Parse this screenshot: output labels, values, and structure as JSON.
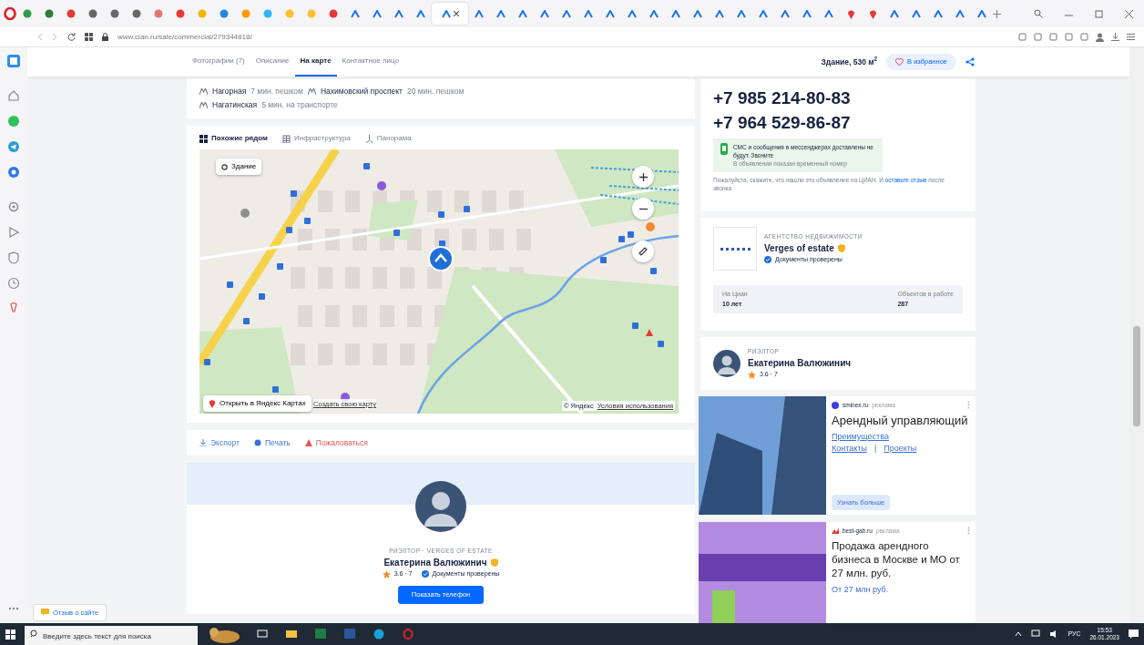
{
  "browser": {
    "tabs": [
      {
        "kind": "site",
        "color": "#2e9d4a",
        "selected": false
      },
      {
        "kind": "site",
        "color": "#2e7d32",
        "selected": false
      },
      {
        "kind": "site",
        "color": "#e53935",
        "selected": false
      },
      {
        "kind": "site",
        "color": "#666666",
        "selected": false
      },
      {
        "kind": "site",
        "color": "#666666",
        "selected": false
      },
      {
        "kind": "site",
        "color": "#666666",
        "selected": false
      },
      {
        "kind": "site",
        "color": "#e57373",
        "selected": false
      },
      {
        "kind": "site",
        "color": "#e53935",
        "selected": false
      },
      {
        "kind": "site",
        "color": "#f4b400",
        "selected": false
      },
      {
        "kind": "site",
        "color": "#1e88e5",
        "selected": false
      },
      {
        "kind": "site",
        "color": "#ff9800",
        "selected": false
      },
      {
        "kind": "site",
        "color": "#29b6f6",
        "selected": false
      },
      {
        "kind": "site",
        "color": "#fbc02d",
        "selected": false
      },
      {
        "kind": "site",
        "color": "#fbc02d",
        "selected": false
      },
      {
        "kind": "site",
        "color": "#e53935",
        "selected": false
      },
      {
        "kind": "cian",
        "color": "#1a73e8",
        "selected": false
      },
      {
        "kind": "cian",
        "color": "#1a73e8",
        "selected": false
      },
      {
        "kind": "cian",
        "color": "#1a73e8",
        "selected": false
      },
      {
        "kind": "cian",
        "color": "#1a73e8",
        "selected": false
      },
      {
        "kind": "cian",
        "color": "#1a73e8",
        "selected": true
      },
      {
        "kind": "cian",
        "color": "#1a73e8",
        "selected": false
      },
      {
        "kind": "cian",
        "color": "#1a73e8",
        "selected": false
      },
      {
        "kind": "cian",
        "color": "#1a73e8",
        "selected": false
      },
      {
        "kind": "cian",
        "color": "#1a73e8",
        "selected": false
      },
      {
        "kind": "cian",
        "color": "#1a73e8",
        "selected": false
      },
      {
        "kind": "cian",
        "color": "#1a73e8",
        "selected": false
      },
      {
        "kind": "cian",
        "color": "#1a73e8",
        "selected": false
      },
      {
        "kind": "cian",
        "color": "#1a73e8",
        "selected": false
      },
      {
        "kind": "cian",
        "color": "#1a73e8",
        "selected": false
      },
      {
        "kind": "cian",
        "color": "#1a73e8",
        "selected": false
      },
      {
        "kind": "cian",
        "color": "#1a73e8",
        "selected": false
      },
      {
        "kind": "cian",
        "color": "#1a73e8",
        "selected": false
      },
      {
        "kind": "cian",
        "color": "#1a73e8",
        "selected": false
      },
      {
        "kind": "cian",
        "color": "#1a73e8",
        "selected": false
      },
      {
        "kind": "cian",
        "color": "#1a73e8",
        "selected": false
      },
      {
        "kind": "cian",
        "color": "#1a73e8",
        "selected": false
      },
      {
        "kind": "cian",
        "color": "#1a73e8",
        "selected": false
      },
      {
        "kind": "pin",
        "color": "#e53935",
        "selected": false
      },
      {
        "kind": "pin",
        "color": "#e53935",
        "selected": false
      },
      {
        "kind": "cian",
        "color": "#1a73e8",
        "selected": false
      },
      {
        "kind": "cian",
        "color": "#1a73e8",
        "selected": false
      },
      {
        "kind": "cian",
        "color": "#1a73e8",
        "selected": false
      },
      {
        "kind": "cian",
        "color": "#1a73e8",
        "selected": false
      },
      {
        "kind": "cian",
        "color": "#1a73e8",
        "selected": false
      }
    ],
    "url": "www.cian.ru/sale/commercial/279344818/"
  },
  "page": {
    "header": {
      "tabs": [
        {
          "label": "Фотографии (7)",
          "selected": false
        },
        {
          "label": "Описание",
          "selected": false
        },
        {
          "label": "На карте",
          "selected": true
        },
        {
          "label": "Контактное лицо",
          "selected": false
        }
      ],
      "area": "Здание, 530 м$^{2}$",
      "favorite_button": "В избранное"
    },
    "metro": [
      {
        "station": "Нагорная",
        "time": "7 мин. пешком"
      },
      {
        "station": "Нахимовский проспект",
        "time": "20 мин. пешком"
      },
      {
        "station": "Нагатинская",
        "time": "5 мин. на транспорте"
      }
    ],
    "map": {
      "tabs": [
        {
          "label": "Похожие рядом",
          "selected": true
        },
        {
          "label": "Инфраструктура",
          "selected": false
        },
        {
          "label": "Панорама",
          "selected": false
        }
      ],
      "building_chip": "Здание",
      "open_link": "Открыть в Яндекс Картах",
      "create_link": "Создать свою карту",
      "copyright": "© Яндекс",
      "terms_link": "Условия использования"
    },
    "actions": [
      {
        "kind": "export",
        "label": "Экспорт"
      },
      {
        "kind": "print",
        "label": "Печать"
      },
      {
        "kind": "report",
        "label": "Пожаловаться"
      }
    ],
    "agent": {
      "role": "РИЭЛТОР · VERGES OF ESTATE",
      "name": "Екатерина Валюжинич",
      "rating": "3.6 · 7",
      "verified": "Документы проверены",
      "show_phone_button": "Показать телефон"
    },
    "contacts": {
      "phones": [
        "+7 985 214-80-83",
        "+7 964 529-86-87"
      ],
      "sms_note": "СМС и сообщения в мессенджерах доставлены не будут. Звоните",
      "temp_note": "В объявлении показан временный номер",
      "request": "Пожалуйста, скажите, что нашли это объявление на ЦИАН. И",
      "review_link": "оставьте отзыв",
      "request_end": "после звонка"
    },
    "agency": {
      "type": "АГЕНТСТВО НЕДВИЖИМОСТИ",
      "name": "Verges of estate",
      "verified": "Документы проверены",
      "stats": [
        {
          "label": "На Циан",
          "value": "10 лет"
        },
        {
          "label": "Объектов в работе",
          "value": "287"
        }
      ]
    },
    "realtor": {
      "role": "РИЭЛТОР",
      "name": "Екатерина Валюжинич",
      "rating": "3.6 · 7"
    },
    "ads": [
      {
        "source": "sminex.ru",
        "tag": "реклама",
        "title": "Арендный управляющий",
        "links": [
          "Преимущества",
          "Контакты",
          "Проекты"
        ],
        "separator": "|",
        "button": "Узнать больше"
      },
      {
        "source": "best-gab.ru",
        "tag": "реклама",
        "title": "Продажа арендного бизнеса в Москве и МО от 27 млн. руб.",
        "subtitle": "От 27 млн руб."
      }
    ],
    "feedback_button": "Отзыв о сайте"
  },
  "taskbar": {
    "search_placeholder": "Введите здесь текст для поиска",
    "language": "РУС",
    "time": "15:53",
    "date": "26.01.2023"
  }
}
